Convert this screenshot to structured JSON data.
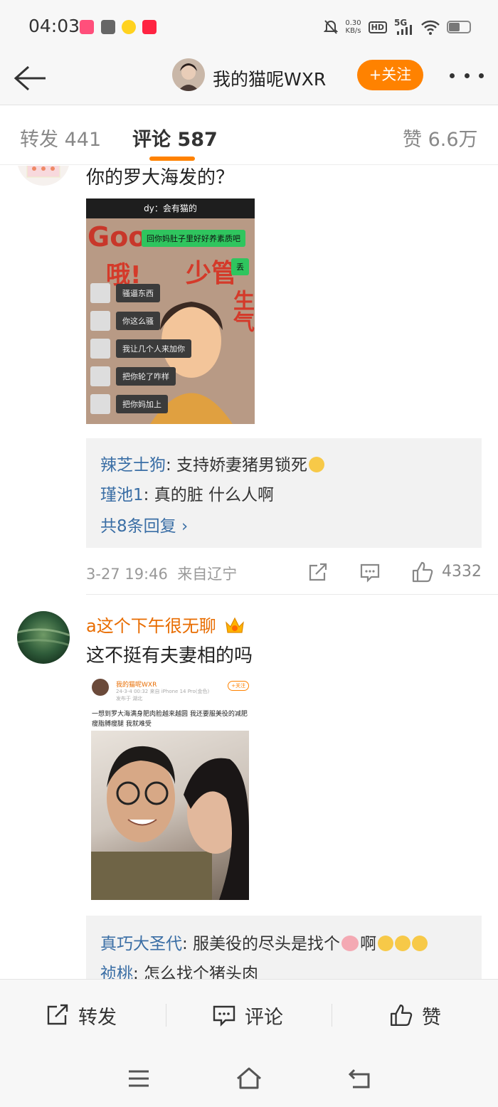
{
  "status_bar": {
    "time": "04:03",
    "net_speed_value": "0.30",
    "net_speed_unit": "KB/s",
    "hd_label": "HD",
    "signal_label": "5G",
    "battery_level": 0.55
  },
  "header": {
    "user_name": "我的猫呢WXR",
    "follow_label": "+关注"
  },
  "tabs": {
    "repost_label": "转发",
    "repost_count": "441",
    "comment_label": "评论",
    "comment_count": "587",
    "like_label": "赞",
    "like_count": "6.6万"
  },
  "comment1": {
    "text": "你的罗大海发的？",
    "image": {
      "header": "dy：会有猫的",
      "bg_text_1": "Goo",
      "bg_text_2": "哦!",
      "bg_text_3": "少管",
      "bg_text_4": "生气",
      "green_bubbles": [
        "回你妈肚子里好好养素质吧",
        "丢"
      ],
      "dark_bubbles": [
        "骚逼东西",
        "你这么骚",
        "我让几个人来加你",
        "把你轮了咋样",
        "把你妈加上"
      ]
    },
    "replies": [
      {
        "user": "辣芝士狗",
        "text": ": 支持娇妻猪男锁死"
      },
      {
        "user": "瑾池1",
        "text": ": 真的脏 什么人啊"
      }
    ],
    "more_replies": "共8条回复 ›",
    "time": "3-27 19:46",
    "location": "来自辽宁",
    "likes": "4332"
  },
  "comment2": {
    "user": "a这个下午很无聊",
    "text": "这不挺有夫妻相的吗",
    "image": {
      "name": "我的猫呢WXR",
      "time": "24-3-4 00:32  来自 iPhone 14 Pro(金色)",
      "location": "发布于 湖北",
      "follow": "+关注",
      "text": "一想到罗大海满身肥肉脸越来越圆 我还要服美役的减肥瘦脂膊瘦腿 我就难受"
    },
    "replies": [
      {
        "user": "真巧大圣代",
        "text": ": 服美役的尽头是找个",
        "text_after": "啊"
      },
      {
        "user": "祯桃",
        "text": ": 怎么找个猪头肉"
      }
    ]
  },
  "bottom_bar": {
    "repost": "转发",
    "comment": "评论",
    "like": "赞"
  }
}
